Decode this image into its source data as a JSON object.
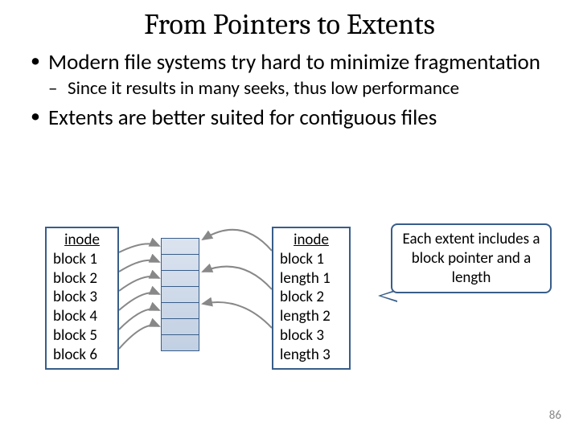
{
  "title": "From Pointers to Extents",
  "bullets": {
    "b1": "Modern file systems try hard to minimize fragmentation",
    "b1sub": "Since it results in many seeks, thus low performance",
    "b2": "Extents are better suited for contiguous files"
  },
  "inode_left": {
    "header": "inode",
    "rows": [
      "block 1",
      "block 2",
      "block 3",
      "block 4",
      "block 5",
      "block 6"
    ]
  },
  "inode_right": {
    "header": "inode",
    "rows": [
      "block 1",
      "length 1",
      "block 2",
      "length 2",
      "block 3",
      "length 3"
    ]
  },
  "callout": "Each extent includes a block pointer and a length",
  "page": "86"
}
